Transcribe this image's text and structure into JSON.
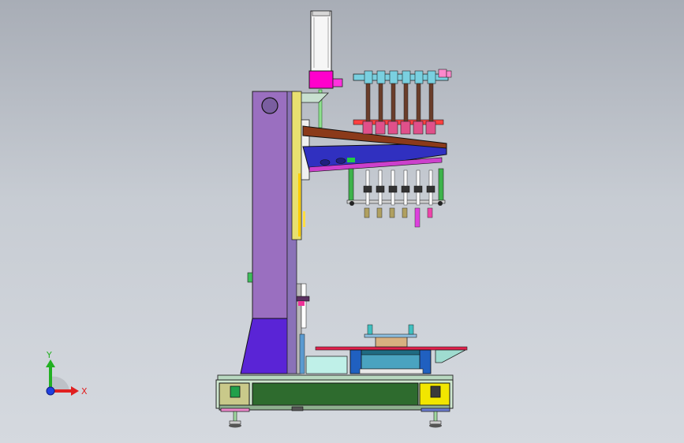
{
  "viewport": {
    "background_top": "#a8adb6",
    "background_bottom": "#d5d9df"
  },
  "triad": {
    "x_label": "X",
    "y_label": "Y",
    "x_color": "#e02020",
    "y_color": "#22b022",
    "z_color": "#2040e0"
  },
  "model": {
    "column_color": "#9a6fc0",
    "motor_color": "#ff00cc",
    "arm_color": "#8b3a1a",
    "base_frame_color": "#2e6b2e",
    "carriage_color": "#3030c0",
    "table_color": "#e0204a",
    "spindle_count": 6
  }
}
